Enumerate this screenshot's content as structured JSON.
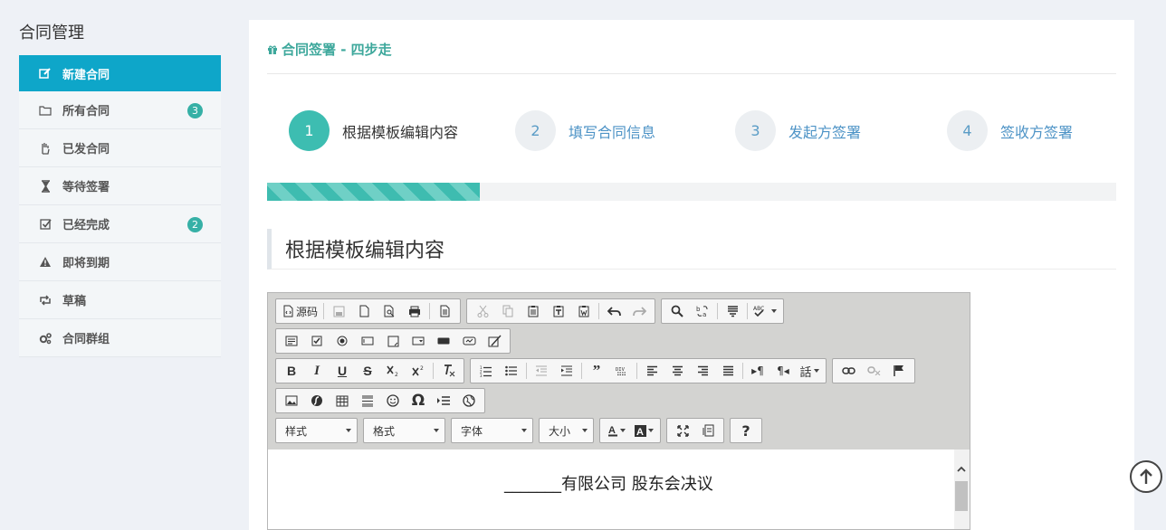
{
  "sidebar": {
    "title": "合同管理",
    "items": [
      {
        "label": "新建合同",
        "icon": "edit-icon",
        "active": true
      },
      {
        "label": "所有合同",
        "icon": "folder-icon",
        "badge": "3"
      },
      {
        "label": "已发合同",
        "icon": "hand-icon"
      },
      {
        "label": "等待签署",
        "icon": "hourglass-icon"
      },
      {
        "label": "已经完成",
        "icon": "check-square-icon",
        "badge": "2"
      },
      {
        "label": "即将到期",
        "icon": "warning-icon"
      },
      {
        "label": "草稿",
        "icon": "retweet-icon"
      },
      {
        "label": "合同群组",
        "icon": "gears-icon"
      }
    ]
  },
  "main": {
    "header": "合同签署 - 四步走",
    "steps": [
      {
        "num": "1",
        "label": "根据模板编辑内容"
      },
      {
        "num": "2",
        "label": "填写合同信息"
      },
      {
        "num": "3",
        "label": "发起方签署"
      },
      {
        "num": "4",
        "label": "签收方签署"
      }
    ],
    "progress": 0.25,
    "section_title": "根据模板编辑内容"
  },
  "editor": {
    "source_label": "源码",
    "combos": {
      "styles": "样式",
      "format": "格式",
      "font": "字体",
      "size": "大小"
    },
    "help_label": "?",
    "omega_label": "Ω",
    "doc_title": "_______有限公司 股东会决议"
  },
  "colors": {
    "accent": "#0ea6c9",
    "teal": "#3dbdb1",
    "link": "#4d93c6"
  }
}
